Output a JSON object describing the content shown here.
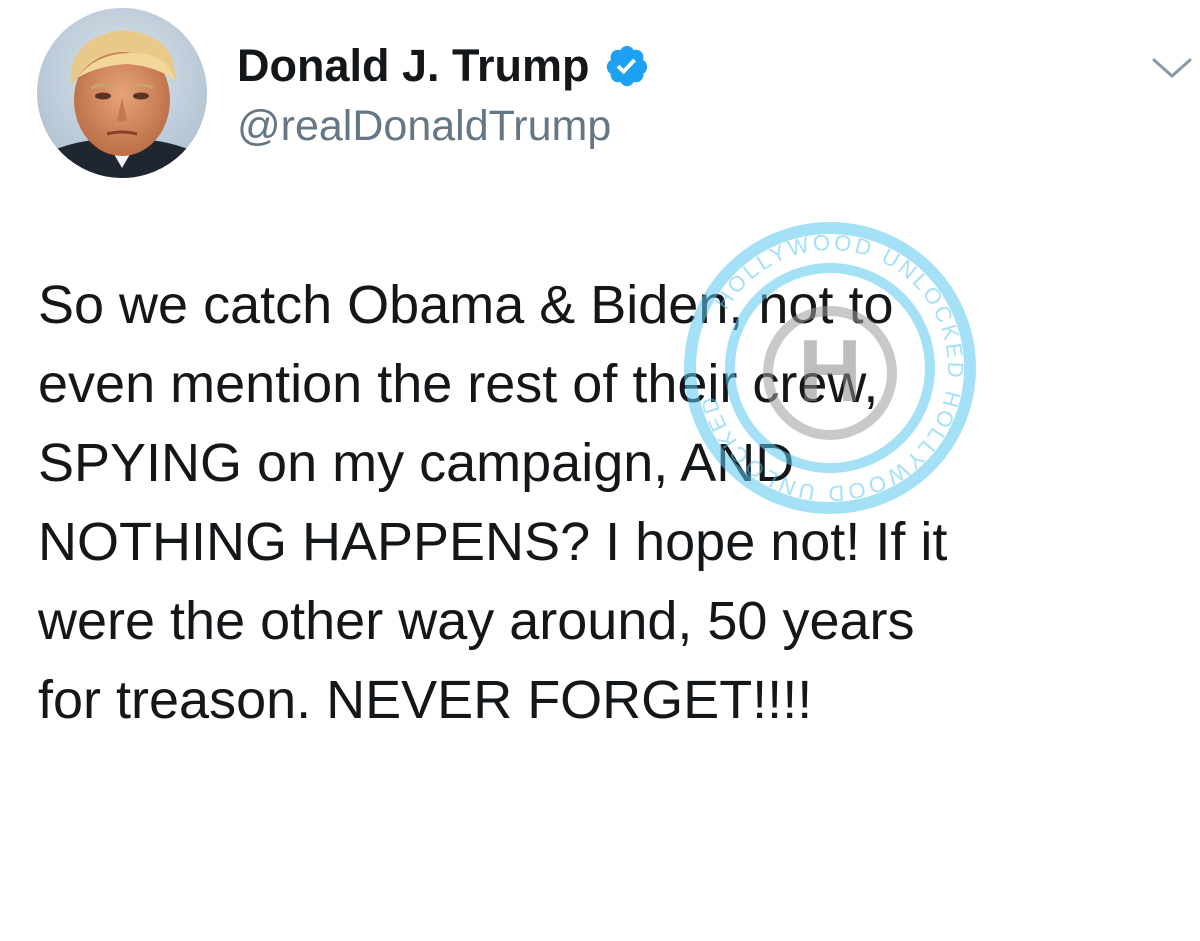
{
  "author": {
    "display_name": "Donald J. Trump",
    "handle": "@realDonaldTrump",
    "verified": true
  },
  "tweet": {
    "text": "So we catch Obama & Biden, not to\neven mention the rest of their crew,\nSPYING on my campaign, AND\nNOTHING HAPPENS? I hope not! If it\nwere the other way around, 50 years\nfor treason. NEVER FORGET!!!!"
  },
  "watermark": {
    "text": "HOLLYWOOD UNLOCKED",
    "monogram": "H"
  },
  "icons": {
    "verified": "verified-badge-icon",
    "menu": "chevron-down-icon"
  },
  "colors": {
    "verified_blue": "#1da1f2",
    "handle_gray": "#657786",
    "text": "#14171a",
    "chevron": "#8899a6",
    "watermark": "#5bc8f0"
  }
}
